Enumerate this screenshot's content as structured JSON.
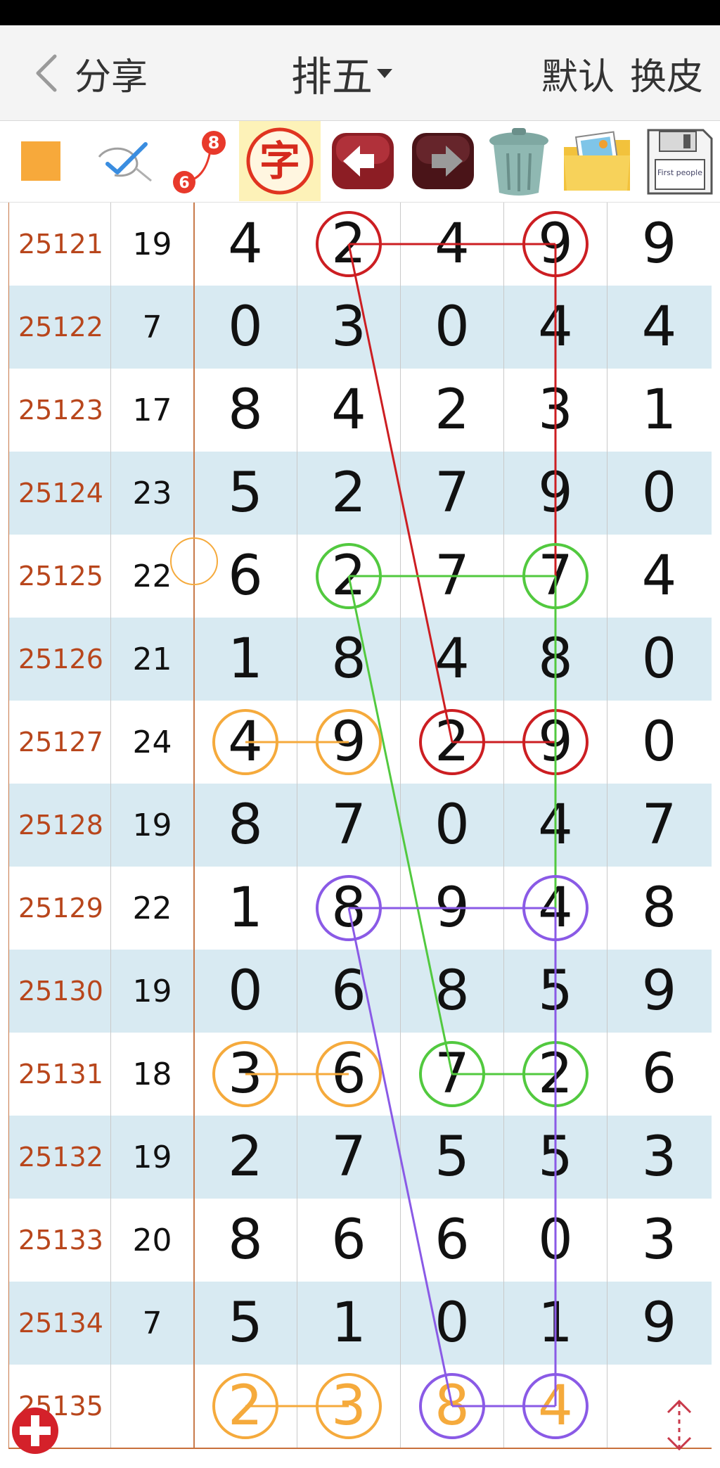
{
  "header": {
    "back_label": "分享",
    "title": "排五",
    "skin_default": "默认",
    "skin_change": "换皮"
  },
  "toolbar": {
    "items": [
      {
        "name": "color-square",
        "color": "#f7a93b"
      },
      {
        "name": "pen-check"
      },
      {
        "name": "line-count",
        "label_top": "8",
        "label_bottom": "6"
      },
      {
        "name": "text-tool",
        "label": "字",
        "active": true
      },
      {
        "name": "undo"
      },
      {
        "name": "redo"
      },
      {
        "name": "trash"
      },
      {
        "name": "gallery"
      },
      {
        "name": "save",
        "label": "First people"
      }
    ]
  },
  "colors": {
    "red": "#cc1e22",
    "green": "#52c93f",
    "purple": "#8a5ae6",
    "orange": "#f5aa3c",
    "period_text": "#b8461c",
    "row_alt": "#d8eaf2"
  },
  "rows": [
    {
      "period": "25121",
      "sum": "19",
      "d": [
        "4",
        "2",
        "4",
        "9",
        "9"
      ]
    },
    {
      "period": "25122",
      "sum": "7",
      "d": [
        "0",
        "3",
        "0",
        "4",
        "4"
      ]
    },
    {
      "period": "25123",
      "sum": "17",
      "d": [
        "8",
        "4",
        "2",
        "3",
        "1"
      ]
    },
    {
      "period": "25124",
      "sum": "23",
      "d": [
        "5",
        "2",
        "7",
        "9",
        "0"
      ]
    },
    {
      "period": "25125",
      "sum": "22",
      "d": [
        "6",
        "2",
        "7",
        "7",
        "4"
      ]
    },
    {
      "period": "25126",
      "sum": "21",
      "d": [
        "1",
        "8",
        "4",
        "8",
        "0"
      ]
    },
    {
      "period": "25127",
      "sum": "24",
      "d": [
        "4",
        "9",
        "2",
        "9",
        "0"
      ]
    },
    {
      "period": "25128",
      "sum": "19",
      "d": [
        "8",
        "7",
        "0",
        "4",
        "7"
      ]
    },
    {
      "period": "25129",
      "sum": "22",
      "d": [
        "1",
        "8",
        "9",
        "4",
        "8"
      ]
    },
    {
      "period": "25130",
      "sum": "19",
      "d": [
        "0",
        "6",
        "8",
        "5",
        "9"
      ]
    },
    {
      "period": "25131",
      "sum": "18",
      "d": [
        "3",
        "6",
        "7",
        "2",
        "6"
      ]
    },
    {
      "period": "25132",
      "sum": "19",
      "d": [
        "2",
        "7",
        "5",
        "5",
        "3"
      ]
    },
    {
      "period": "25133",
      "sum": "20",
      "d": [
        "8",
        "6",
        "6",
        "0",
        "3"
      ]
    },
    {
      "period": "25134",
      "sum": "7",
      "d": [
        "5",
        "1",
        "0",
        "1",
        "9"
      ]
    },
    {
      "period": "25135",
      "sum": "",
      "d": [
        "2",
        "3",
        "8",
        "4",
        ""
      ],
      "predicted": true
    }
  ],
  "annotations": {
    "red": {
      "circles": [
        [
          0,
          1
        ],
        [
          0,
          3
        ],
        [
          6,
          2
        ],
        [
          6,
          3
        ]
      ],
      "segments": [
        [
          [
            0,
            1
          ],
          [
            0,
            3
          ]
        ],
        [
          [
            0,
            3
          ],
          [
            6,
            3
          ]
        ],
        [
          [
            0,
            1
          ],
          [
            6,
            2
          ]
        ],
        [
          [
            6,
            2
          ],
          [
            6,
            3
          ]
        ]
      ]
    },
    "green": {
      "circles": [
        [
          4,
          1
        ],
        [
          4,
          3
        ],
        [
          10,
          2
        ],
        [
          10,
          3
        ]
      ],
      "segments": [
        [
          [
            4,
            1
          ],
          [
            4,
            3
          ]
        ],
        [
          [
            4,
            3
          ],
          [
            10,
            3
          ]
        ],
        [
          [
            4,
            1
          ],
          [
            10,
            2
          ]
        ],
        [
          [
            10,
            2
          ],
          [
            10,
            3
          ]
        ]
      ]
    },
    "purple": {
      "circles": [
        [
          8,
          1
        ],
        [
          8,
          3
        ],
        [
          14,
          2
        ],
        [
          14,
          3
        ]
      ],
      "segments": [
        [
          [
            8,
            1
          ],
          [
            8,
            3
          ]
        ],
        [
          [
            8,
            3
          ],
          [
            14,
            3
          ]
        ],
        [
          [
            8,
            1
          ],
          [
            14,
            2
          ]
        ],
        [
          [
            14,
            2
          ],
          [
            14,
            3
          ]
        ]
      ]
    },
    "orange": {
      "circles": [
        [
          6,
          0
        ],
        [
          6,
          1
        ],
        [
          10,
          0
        ],
        [
          10,
          1
        ],
        [
          14,
          0
        ],
        [
          14,
          1
        ]
      ],
      "segments": [
        [
          [
            6,
            0
          ],
          [
            6,
            1
          ]
        ],
        [
          [
            10,
            0
          ],
          [
            10,
            1
          ]
        ],
        [
          [
            14,
            0
          ],
          [
            14,
            1
          ]
        ]
      ]
    }
  },
  "predicted_colors": [
    "orange",
    "orange",
    "orange",
    "orange",
    ""
  ]
}
